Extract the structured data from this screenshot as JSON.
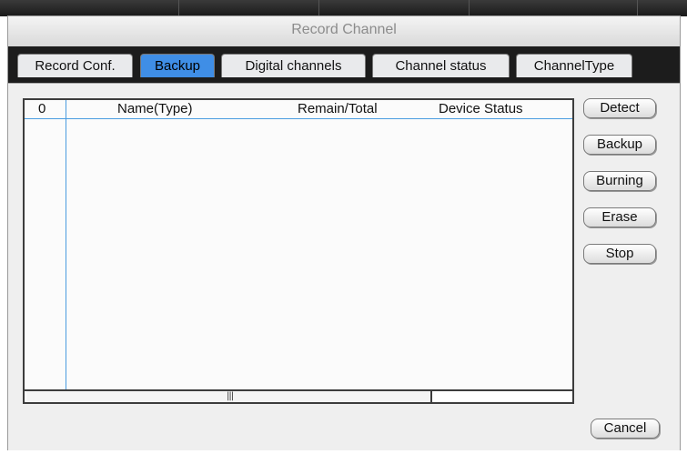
{
  "window": {
    "title": "Record Channel"
  },
  "tabs": [
    {
      "label": "Record Conf.",
      "active": false
    },
    {
      "label": "Backup",
      "active": true
    },
    {
      "label": "Digital channels",
      "active": false
    },
    {
      "label": "Channel status",
      "active": false
    },
    {
      "label": "ChannelType",
      "active": false
    }
  ],
  "device_list": {
    "columns": [
      "0",
      "Name(Type)",
      "Remain/Total",
      "Device Status"
    ],
    "rows": [],
    "scroll_grip": "|||"
  },
  "actions": {
    "detect": "Detect",
    "backup": "Backup",
    "burning": "Burning",
    "erase": "Erase",
    "stop": "Stop",
    "cancel": "Cancel"
  },
  "colors": {
    "tab_active": "#3f8ee6",
    "tab_strip": "#1c1c1c",
    "grid_line": "#4a9ce0",
    "title_text": "#8c8c8c"
  }
}
